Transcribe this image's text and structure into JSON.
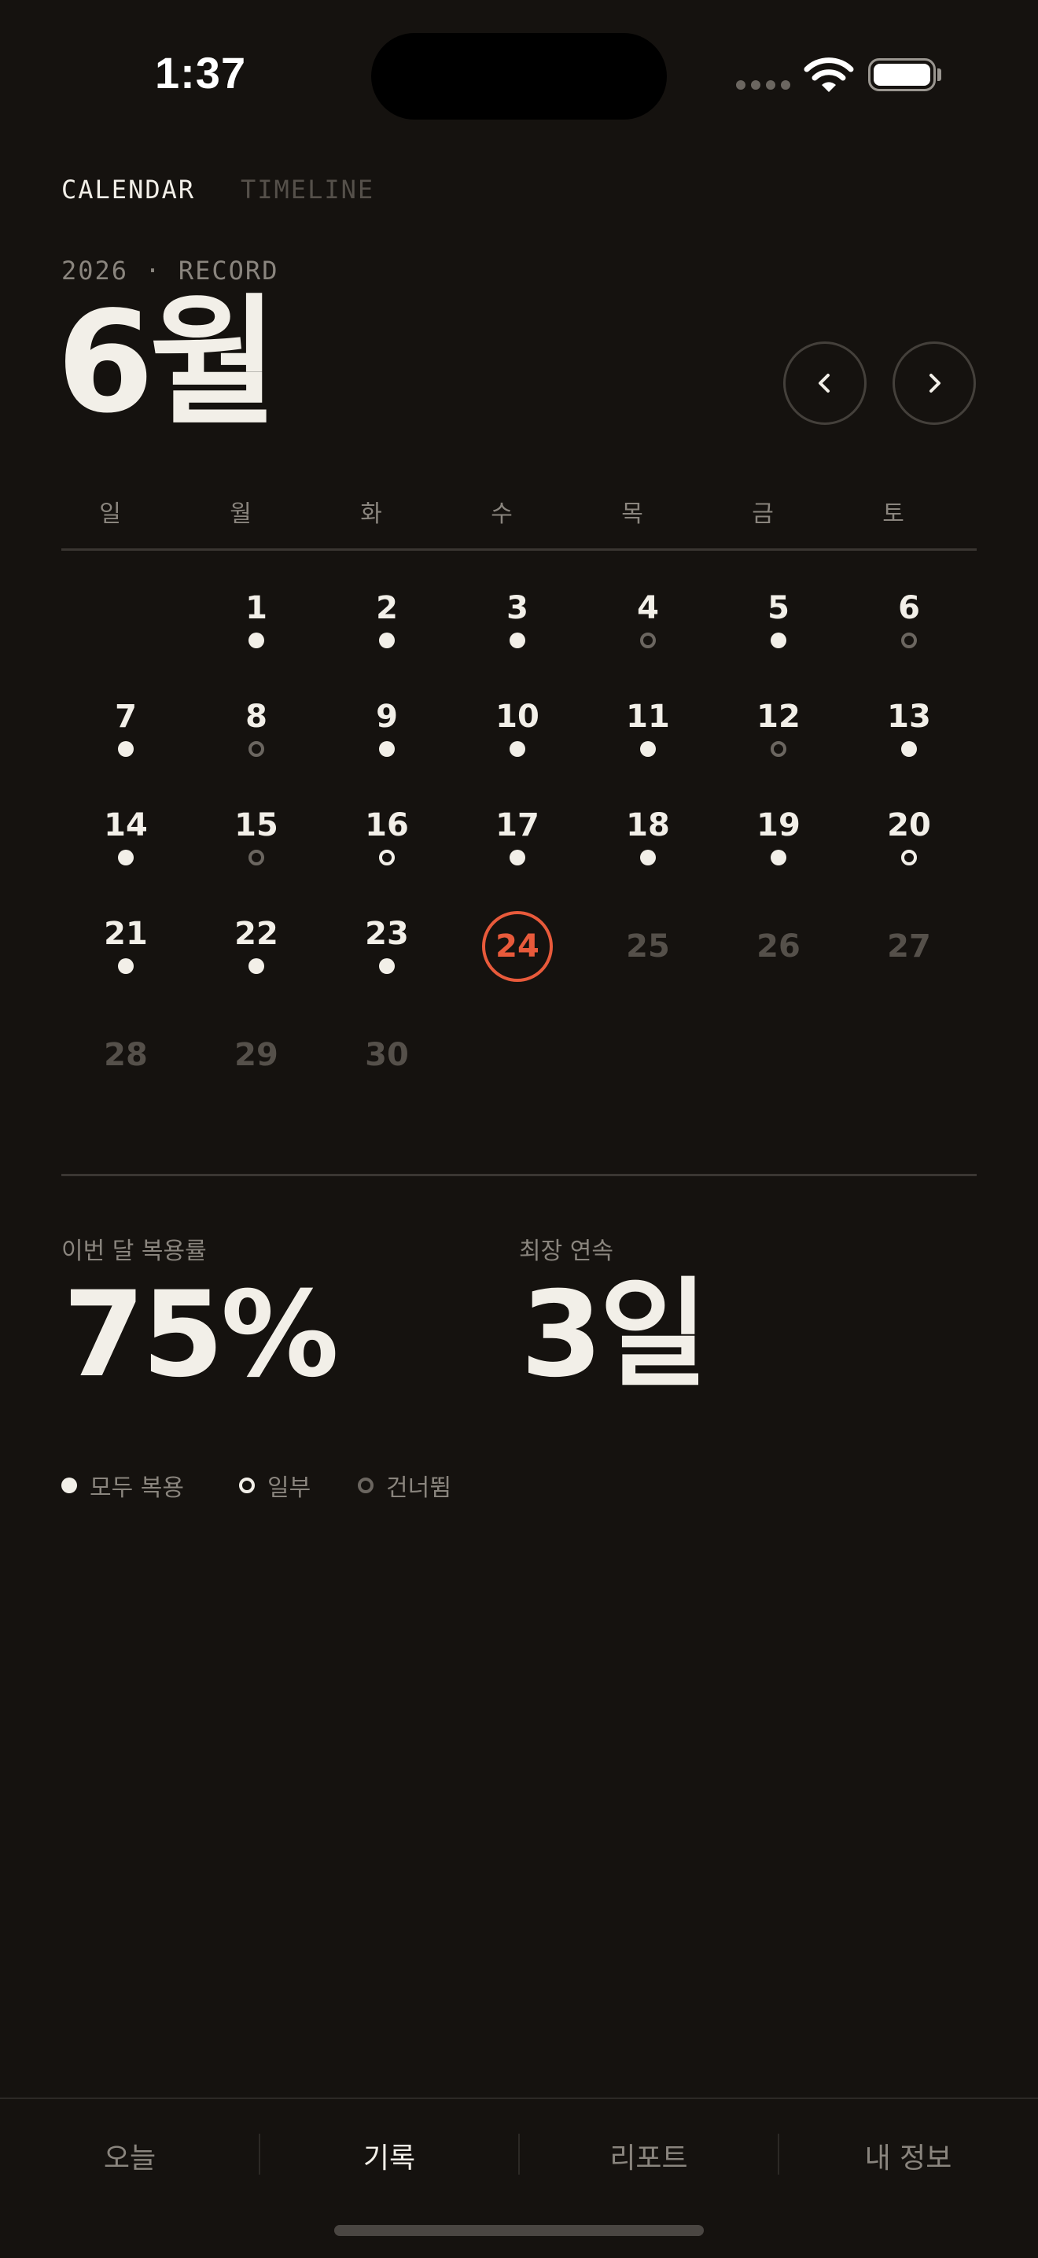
{
  "status_bar": {
    "time": "1:37"
  },
  "tabs": [
    {
      "label": "CALENDAR",
      "active": true
    },
    {
      "label": "TIMELINE",
      "active": false
    }
  ],
  "header": {
    "kicker": "2026 · RECORD",
    "month": "6월"
  },
  "icons": {
    "prev": "chevron-left-icon",
    "next": "chevron-right-icon"
  },
  "weekdays": [
    "일",
    "월",
    "화",
    "수",
    "목",
    "금",
    "토"
  ],
  "days": [
    {
      "n": "1",
      "s": "full"
    },
    {
      "n": "2",
      "s": "full"
    },
    {
      "n": "3",
      "s": "full"
    },
    {
      "n": "4",
      "s": "skipped"
    },
    {
      "n": "5",
      "s": "full"
    },
    {
      "n": "6",
      "s": "skipped"
    },
    {
      "n": "7",
      "s": "full"
    },
    {
      "n": "8",
      "s": "skipped"
    },
    {
      "n": "9",
      "s": "full"
    },
    {
      "n": "10",
      "s": "full"
    },
    {
      "n": "11",
      "s": "full"
    },
    {
      "n": "12",
      "s": "skipped"
    },
    {
      "n": "13",
      "s": "full"
    },
    {
      "n": "14",
      "s": "full"
    },
    {
      "n": "15",
      "s": "skipped"
    },
    {
      "n": "16",
      "s": "partial"
    },
    {
      "n": "17",
      "s": "full"
    },
    {
      "n": "18",
      "s": "full"
    },
    {
      "n": "19",
      "s": "full"
    },
    {
      "n": "20",
      "s": "partial"
    },
    {
      "n": "21",
      "s": "full"
    },
    {
      "n": "22",
      "s": "full"
    },
    {
      "n": "23",
      "s": "full"
    },
    {
      "n": "24",
      "s": "today"
    },
    {
      "n": "25",
      "s": "future"
    },
    {
      "n": "26",
      "s": "future"
    },
    {
      "n": "27",
      "s": "future"
    },
    {
      "n": "28",
      "s": "future"
    },
    {
      "n": "29",
      "s": "future"
    },
    {
      "n": "30",
      "s": "future"
    }
  ],
  "stats": {
    "adherence_label": "이번 달 복용률",
    "adherence_value": "75%",
    "streak_label": "최장 연속",
    "streak_value": "3일"
  },
  "legend": [
    {
      "label": "모두 복용",
      "type": "full"
    },
    {
      "label": "일부",
      "type": "partial"
    },
    {
      "label": "건너뜀",
      "type": "skipped"
    }
  ],
  "bottom_nav": [
    {
      "label": "오늘",
      "active": false
    },
    {
      "label": "기록",
      "active": true
    },
    {
      "label": "리포트",
      "active": false
    },
    {
      "label": "내 정보",
      "active": false
    }
  ],
  "colors": {
    "background": "#15120f",
    "text": "#f2efe8",
    "muted": "#8a857e",
    "accent": "#e85a3b"
  }
}
